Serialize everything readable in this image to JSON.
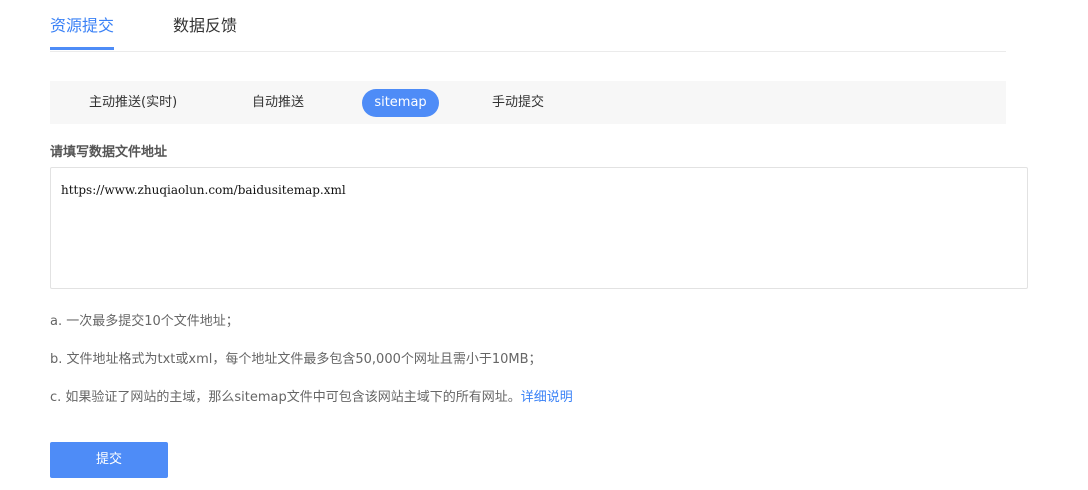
{
  "top_tabs": [
    {
      "label": "资源提交",
      "active": true
    },
    {
      "label": "数据反馈",
      "active": false
    }
  ],
  "sub_tabs": [
    {
      "label": "主动推送(实时)",
      "active": false
    },
    {
      "label": "自动推送",
      "active": false
    },
    {
      "label": "sitemap",
      "active": true
    },
    {
      "label": "手动提交",
      "active": false
    }
  ],
  "form": {
    "label": "请填写数据文件地址",
    "url_value": "https://www.zhuqiaolun.com/baidusitemap.xml"
  },
  "notes": {
    "a": "a. 一次最多提交10个文件地址；",
    "b": "b. 文件地址格式为txt或xml，每个地址文件最多包含50,000个网址且需小于10MB；",
    "c": "c. 如果验证了网站的主域，那么sitemap文件中可包含该网站主域下的所有网址。",
    "detail_link": "详细说明"
  },
  "submit_label": "提交",
  "colors": {
    "accent": "#4e8cf7",
    "link": "#3b82f6"
  }
}
